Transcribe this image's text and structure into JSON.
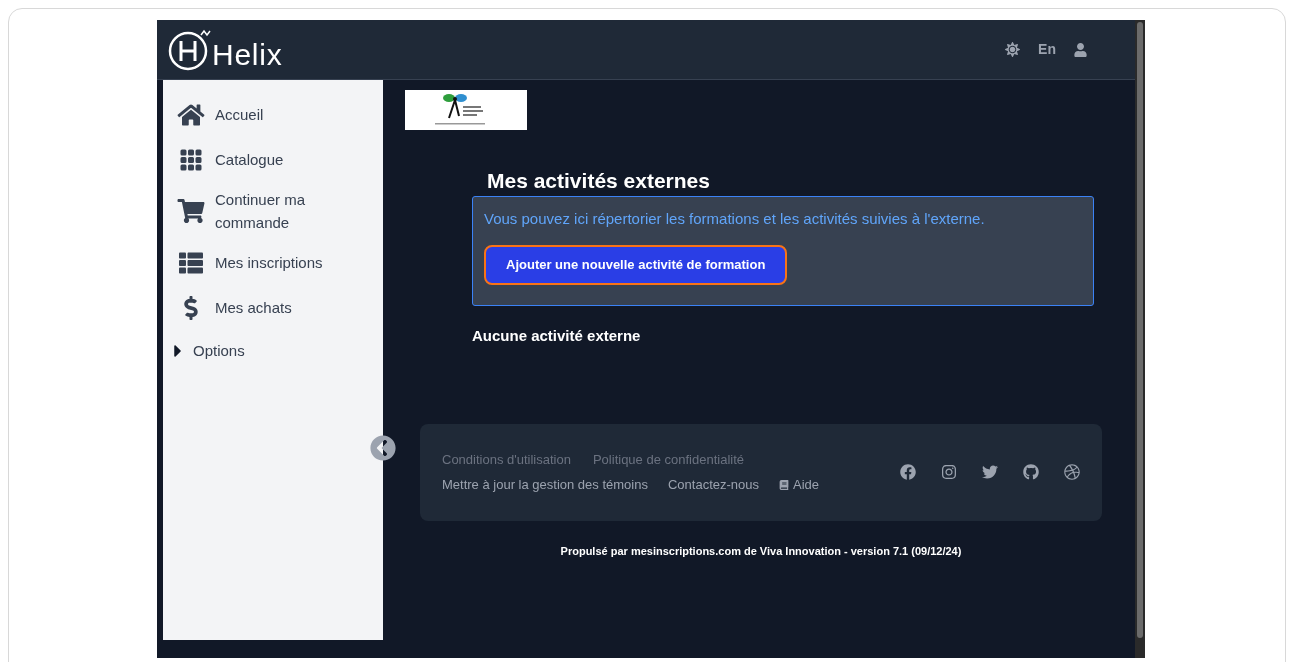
{
  "header": {
    "brand": "Helix",
    "language": "En"
  },
  "sidebar": {
    "items": [
      {
        "kind": "link",
        "label": "Accueil"
      },
      {
        "kind": "link",
        "label": "Catalogue"
      },
      {
        "kind": "link",
        "label": "Continuer ma commande"
      },
      {
        "kind": "link",
        "label": "Mes inscriptions"
      },
      {
        "kind": "link",
        "label": "Mes achats"
      },
      {
        "kind": "group",
        "label": "Options",
        "expanded": false
      }
    ]
  },
  "main": {
    "title": "Mes activités externes",
    "info": "Vous pouvez ici répertorier les formations et les activités suivies à l'externe.",
    "add_button": "Ajouter une nouvelle activité de formation",
    "empty_message": "Aucune activité externe"
  },
  "footer": {
    "top_links": [
      "Conditions d'utilisation",
      "Politique de confidentialité"
    ],
    "bottom_links": [
      {
        "kind": "text",
        "label": "Mettre à jour la gestion des témoins"
      },
      {
        "kind": "text",
        "label": "Contactez-nous"
      },
      {
        "kind": "help",
        "label": "Aide"
      }
    ],
    "powered_by": "Propulsé par mesinscriptions.com de Viva Innovation - version 7.1 (09/12/24)"
  }
}
